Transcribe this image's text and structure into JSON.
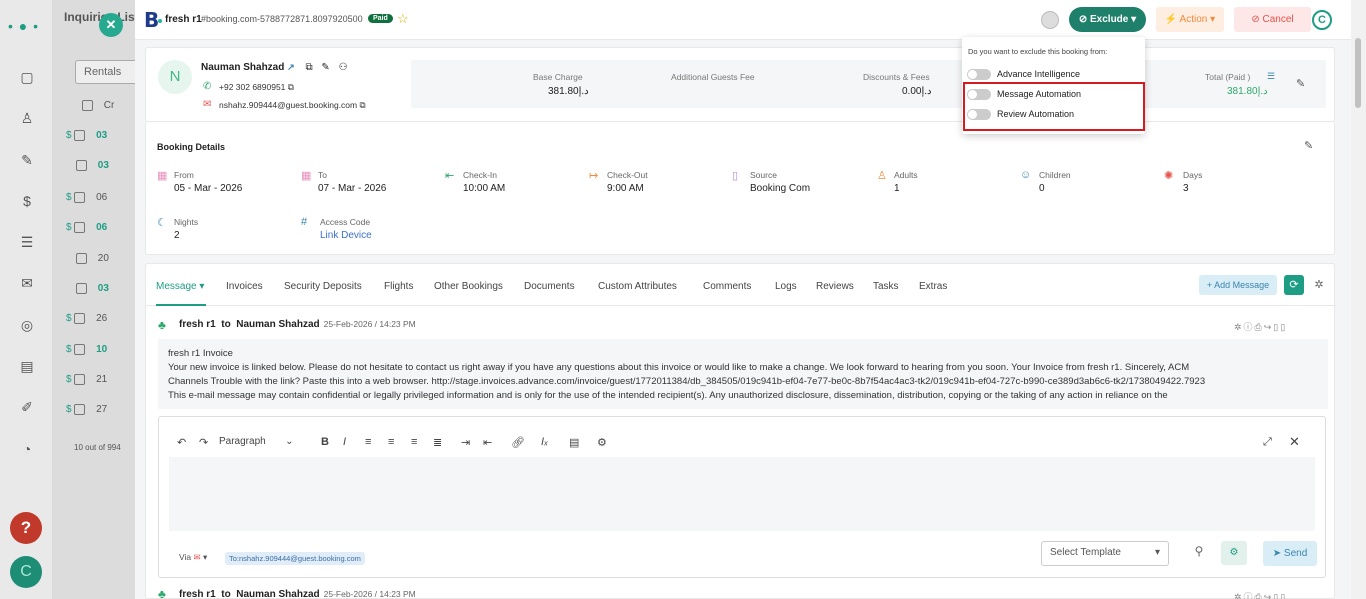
{
  "background": {
    "title": "Inquiries List",
    "rentals_filter": "Rentals",
    "footer": "10 out of 994",
    "col_header": "Cr",
    "rows": [
      {
        "code": "03",
        "paid": true
      },
      {
        "code": "03",
        "paid": false
      },
      {
        "code": "06",
        "paid": true
      },
      {
        "code": "06",
        "paid": true
      },
      {
        "code": "20",
        "paid": false
      },
      {
        "code": "03",
        "paid": false
      },
      {
        "code": "26",
        "paid": true
      },
      {
        "code": "10",
        "paid": true
      },
      {
        "code": "21",
        "paid": true
      },
      {
        "code": "27",
        "paid": true
      }
    ],
    "help_label": "?",
    "c_label": "C"
  },
  "header": {
    "booking_name": "fresh r1",
    "booking_id": "#booking.com-5788772871.8097920500",
    "paid_badge": "Paid",
    "exclude_label": "Exclude",
    "action_label": "Action",
    "cancel_label": "Cancel",
    "avatar_initial": "C"
  },
  "guest": {
    "initial": "N",
    "name": "Nauman Shahzad",
    "phone": "+92 302 6890951",
    "email": "nshahz.909444@guest.booking.com",
    "fees": [
      {
        "label": "Base Charge",
        "value": "381.80د.إ"
      },
      {
        "label": "Additional Guests Fee",
        "value": ""
      },
      {
        "label": "Discounts & Fees",
        "value": "0.00د.إ"
      },
      {
        "label": "Total (Paid )",
        "value": "381.80د.إ"
      }
    ]
  },
  "details": {
    "title": "Booking Details",
    "items": [
      {
        "label": "From",
        "value": "05 - Mar - 2026"
      },
      {
        "label": "To",
        "value": "07 - Mar - 2026"
      },
      {
        "label": "Check-In",
        "value": "10:00 AM"
      },
      {
        "label": "Check-Out",
        "value": "9:00 AM"
      },
      {
        "label": "Source",
        "value": "Booking Com"
      },
      {
        "label": "Adults",
        "value": "1"
      },
      {
        "label": "Children",
        "value": "0"
      },
      {
        "label": "Days",
        "value": "3"
      },
      {
        "label": "Nights",
        "value": "2"
      },
      {
        "label": "Access Code",
        "value": "Link Device"
      }
    ]
  },
  "tabs": [
    "Message",
    "Invoices",
    "Security Deposits",
    "Flights",
    "Other Bookings",
    "Documents",
    "Custom Attributes",
    "Comments",
    "Logs",
    "Reviews",
    "Tasks",
    "Extras"
  ],
  "add_message": "+ Add Message",
  "message": {
    "from": "fresh r1",
    "to_word": "to",
    "to": "Nauman Shahzad",
    "date": "25-Feb-2026 / 14:23 PM",
    "line1": "fresh r1 Invoice",
    "line2": "Your new invoice is linked below. Please do not hesitate to contact us right away if you have any questions about this invoice or would like to make a change. We look forward to hearing from you soon. Your Invoice from fresh r1. Sincerely, ACM",
    "line3": "Channels Trouble with the link? Paste this into a web browser. http://stage.invoices.advance.com/invoice/guest/1772011384/db_384505/019c941b-ef04-7e77-be0c-8b7f54ac4ac3-tk2/019c941b-ef04-727c-b990-ce389d3ab6c6-tk2/1738049422.7923",
    "line4": "This e-mail message may contain confidential or legally privileged information and is only for the use of the intended recipient(s). Any unauthorized disclosure, dissemination, distribution, copying or the taking of any action in reliance on the"
  },
  "editor": {
    "paragraph": "Paragraph",
    "via": "Via",
    "to_chip": "To:nshahz.909444@guest.booking.com",
    "template_placeholder": "Select Template",
    "send": "Send"
  },
  "message2": {
    "from": "fresh r1",
    "to_word": "to",
    "to": "Nauman Shahzad",
    "date": "25-Feb-2026 / 14:23 PM"
  },
  "exclude_dropdown": {
    "question": "Do you want to exclude this booking from:",
    "options": [
      {
        "label": "Advance Intelligence",
        "on": false
      },
      {
        "label": "Message Automation",
        "on": false
      },
      {
        "label": "Review Automation",
        "on": false
      }
    ]
  }
}
